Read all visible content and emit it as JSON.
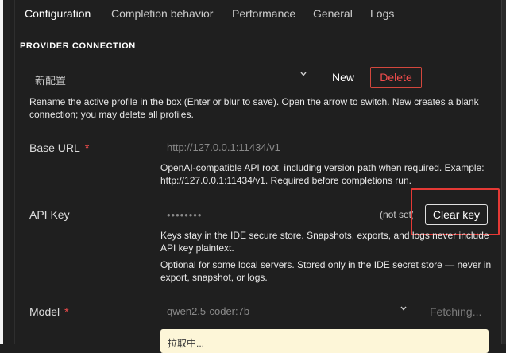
{
  "tabs": [
    {
      "label": "Configuration",
      "active": true
    },
    {
      "label": "Completion behavior"
    },
    {
      "label": "Performance"
    },
    {
      "label": "General"
    },
    {
      "label": "Logs"
    }
  ],
  "section_heading": "PROVIDER CONNECTION",
  "profile": {
    "selected": "新配置",
    "new_label": "New",
    "delete_label": "Delete",
    "help": "Rename the active profile in the box (Enter or blur to save). Open the arrow to switch. New creates a blank connection; you may delete all profiles."
  },
  "base_url": {
    "label": "Base URL",
    "required_mark": "*",
    "placeholder": "http://127.0.0.1:11434/v1",
    "help": "OpenAI-compatible API root, including version path when required. Example: http://127.0.0.1:11434/v1. Required before completions run."
  },
  "api_key": {
    "label": "API Key",
    "masked_value": "••••••••",
    "status": "(not set)",
    "clear_label": "Clear key",
    "help_1": "Keys stay in the IDE secure store. Snapshots, exports, and logs never include API key plaintext.",
    "help_2": "Optional for some local servers. Stored only in the IDE secret store — never in export, snapshot, or logs."
  },
  "model": {
    "label": "Model",
    "required_mark": "*",
    "value": "qwen2.5-coder:7b",
    "fetching_label": "Fetching...",
    "notice": "拉取中..."
  },
  "colors": {
    "background": "#1f1f1f",
    "required": "#f14c4c",
    "delete_border": "#d3473d",
    "highlight": "#e53935",
    "notice_bg": "#fdf6d8"
  },
  "icons": {
    "dropdown": "chevron-down-icon"
  }
}
